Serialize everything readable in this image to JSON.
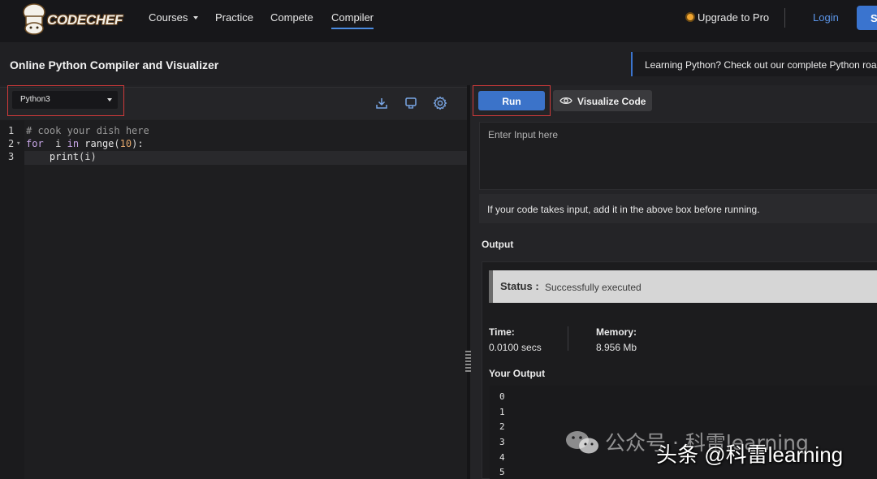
{
  "nav": {
    "logo_text": "CODECHEF",
    "courses": "Courses",
    "practice": "Practice",
    "compete": "Compete",
    "compiler": "Compiler",
    "upgrade": "Upgrade to Pro",
    "login": "Login",
    "signup": "S"
  },
  "header": {
    "title": "Online Python Compiler and Visualizer",
    "banner": "Learning Python? Check out our complete Python roa"
  },
  "editor": {
    "language": "Python3",
    "line_numbers": [
      "1",
      "2",
      "3"
    ],
    "code": [
      "# cook your dish here",
      "for  i in range(10):",
      "    print(i)"
    ]
  },
  "actions": {
    "run": "Run",
    "visualize": "Visualize Code"
  },
  "input": {
    "placeholder": "Enter Input here",
    "hint": "If your code takes input, add it in the above box before running."
  },
  "output": {
    "heading": "Output",
    "status_label": "Status :",
    "status_value": "Successfully executed",
    "time_label": "Time:",
    "time_value": "0.0100 secs",
    "memory_label": "Memory:",
    "memory_value": "8.956 Mb",
    "your_output_label": "Your Output",
    "lines": [
      "0",
      "1",
      "2",
      "3",
      "4",
      "5"
    ]
  },
  "watermark": {
    "line1": "公众号 · 科雷learning",
    "line2": "头条 @科雷learning"
  },
  "colors": {
    "accent": "#3b73c9",
    "highlight_box": "#d03a3a",
    "status_bar": "#d6d6d6"
  }
}
